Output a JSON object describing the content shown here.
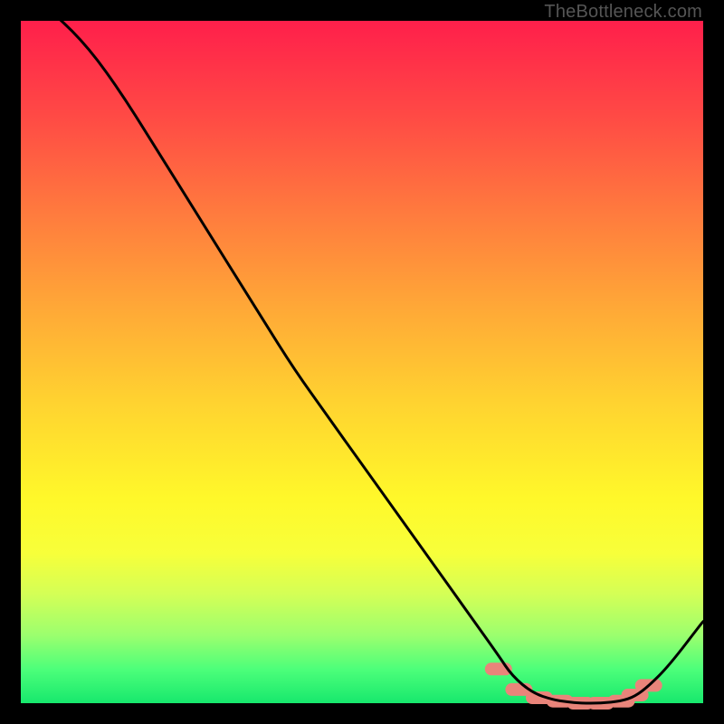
{
  "watermark": "TheBottleneck.com",
  "chart_data": {
    "type": "line",
    "title": "",
    "xlabel": "",
    "ylabel": "",
    "xlim": [
      0,
      100
    ],
    "ylim": [
      0,
      100
    ],
    "series": [
      {
        "name": "curve",
        "x": [
          0,
          5,
          10,
          15,
          20,
          25,
          30,
          35,
          40,
          45,
          50,
          55,
          60,
          65,
          70,
          72,
          75,
          78,
          80,
          82,
          85,
          88,
          90,
          92,
          95,
          100
        ],
        "values": [
          105,
          101,
          96,
          89,
          81,
          73,
          65,
          57,
          49,
          42,
          35,
          28,
          21,
          14,
          7,
          4,
          1.5,
          0.5,
          0.2,
          0,
          0,
          0.3,
          1,
          2.5,
          5.5,
          12
        ]
      }
    ],
    "optimum_band_x": [
      70,
      92
    ],
    "markers": {
      "name": "near-optimum-dots",
      "x": [
        70,
        73,
        76,
        79,
        82,
        85,
        88,
        90,
        92
      ],
      "values": [
        5,
        2,
        0.8,
        0.3,
        0,
        0,
        0.3,
        1.2,
        2.6
      ]
    },
    "gradient_stops": [
      {
        "pos": 0,
        "color": "#ff1f4b"
      },
      {
        "pos": 14,
        "color": "#ff4a45"
      },
      {
        "pos": 28,
        "color": "#ff7a3e"
      },
      {
        "pos": 42,
        "color": "#ffa837"
      },
      {
        "pos": 56,
        "color": "#ffd330"
      },
      {
        "pos": 70,
        "color": "#fff82a"
      },
      {
        "pos": 78,
        "color": "#f7ff3a"
      },
      {
        "pos": 84,
        "color": "#d4ff56"
      },
      {
        "pos": 90,
        "color": "#9cff6e"
      },
      {
        "pos": 95,
        "color": "#4dff7a"
      },
      {
        "pos": 100,
        "color": "#17e86d"
      }
    ]
  }
}
